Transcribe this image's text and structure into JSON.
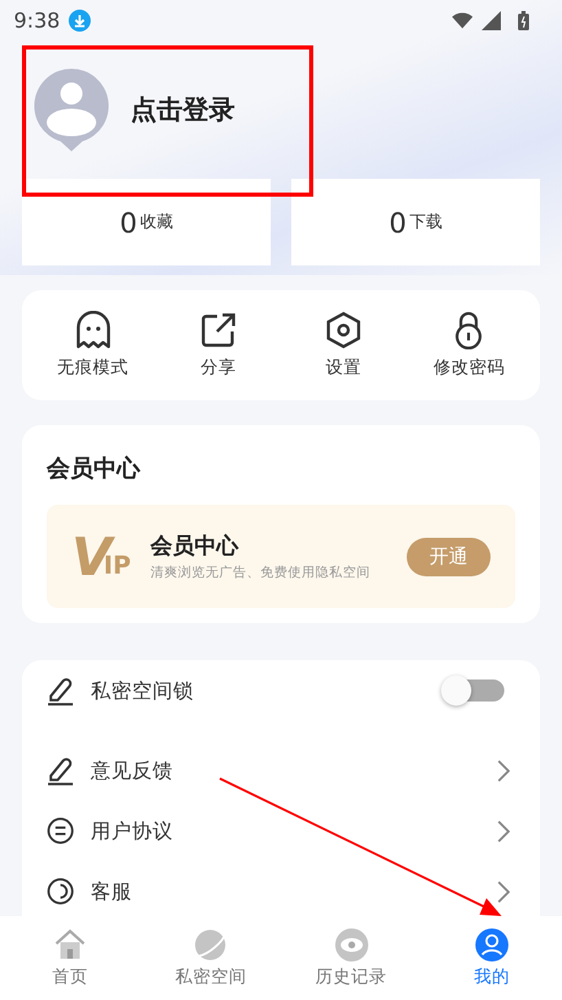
{
  "status_bar": {
    "time": "9:38"
  },
  "profile": {
    "login_text": "点击登录"
  },
  "stats": [
    {
      "count": "0",
      "label": "收藏"
    },
    {
      "count": "0",
      "label": "下载"
    }
  ],
  "quick_actions": [
    {
      "label": "无痕模式"
    },
    {
      "label": "分享"
    },
    {
      "label": "设置"
    },
    {
      "label": "修改密码"
    }
  ],
  "membership": {
    "title": "会员中心",
    "banner": {
      "logo_mark": "V",
      "logo_text": "IP",
      "title": "会员中心",
      "subtitle": "清爽浏览无广告、免费使用隐私空间",
      "button": "开通"
    }
  },
  "settings": [
    {
      "kind": "toggle",
      "label": "私密空间锁",
      "on": false
    },
    {
      "kind": "link",
      "label": "意见反馈"
    },
    {
      "kind": "link",
      "label": "用户协议"
    },
    {
      "kind": "link",
      "label": "客服"
    }
  ],
  "nav": [
    {
      "label": "首页",
      "selected": false
    },
    {
      "label": "私密空间",
      "selected": false
    },
    {
      "label": "历史记录",
      "selected": false
    },
    {
      "label": "我的",
      "selected": true
    }
  ]
}
